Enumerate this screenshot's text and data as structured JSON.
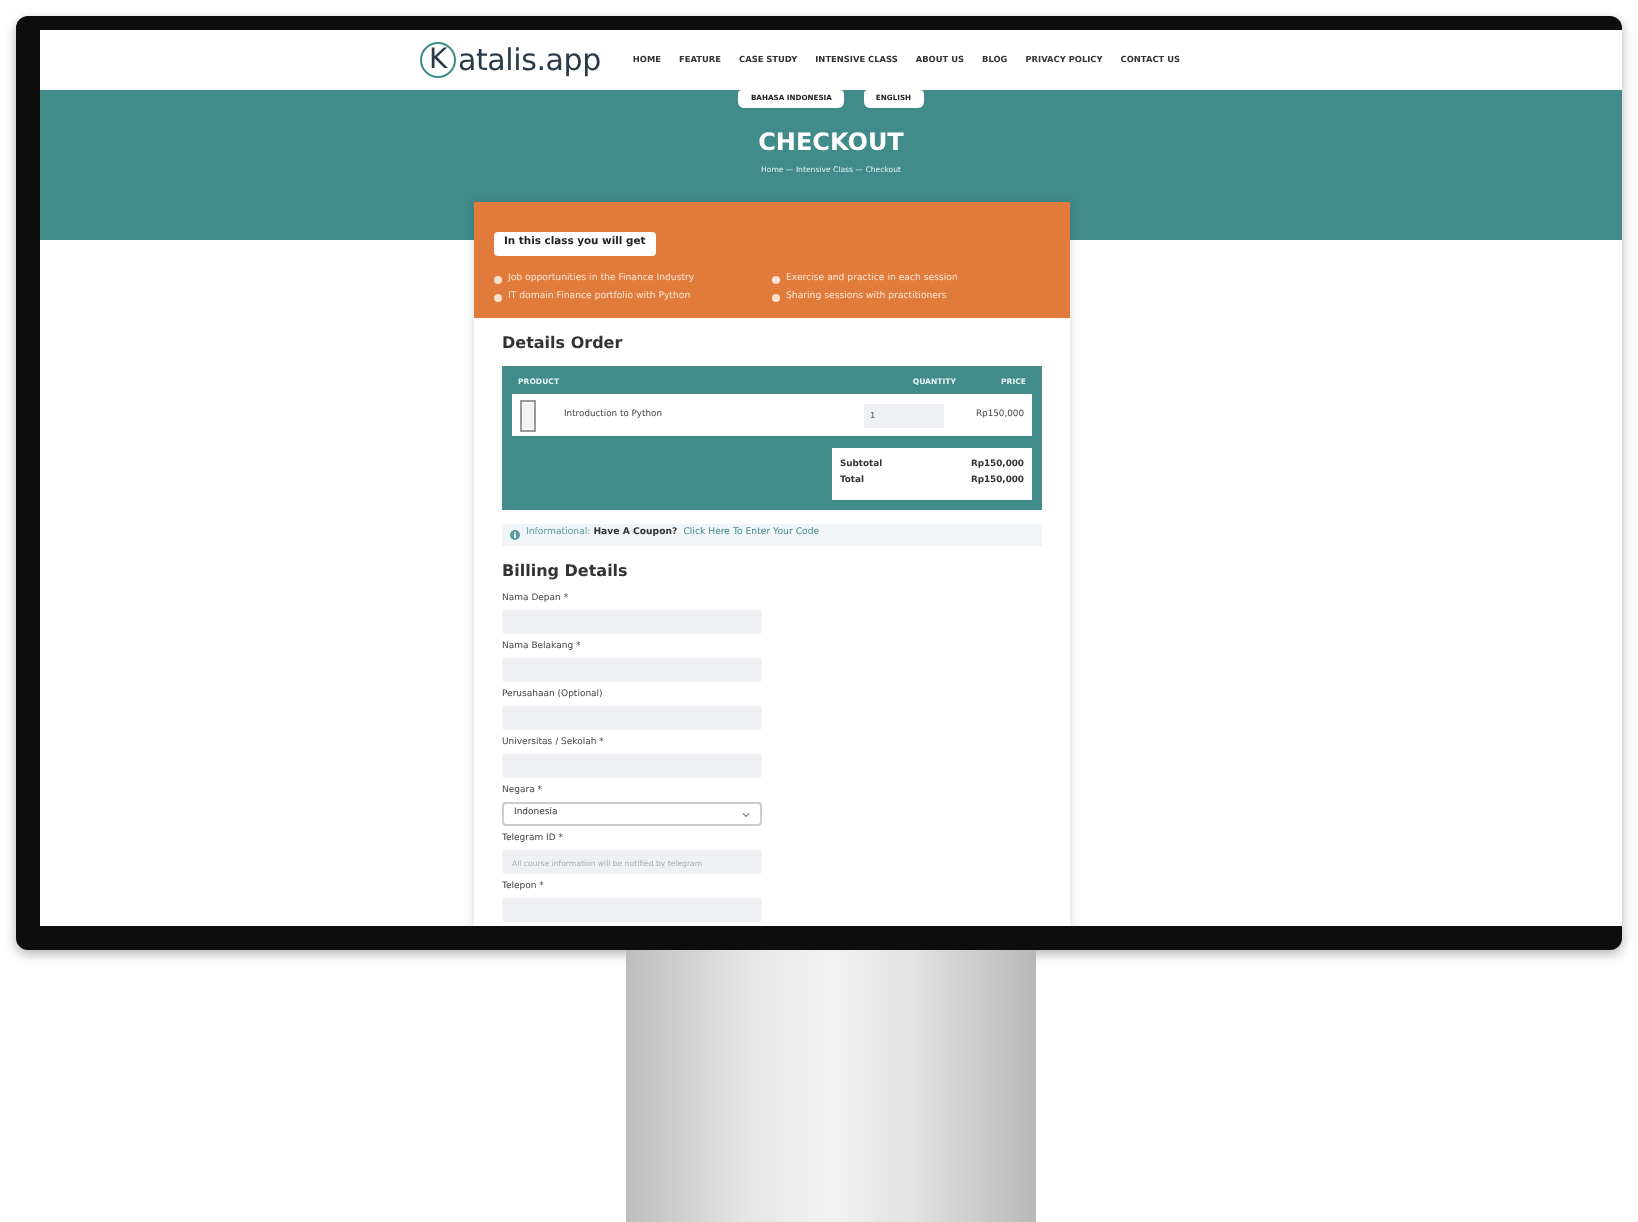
{
  "nav": {
    "logo_letter": "K",
    "logo_rest": "atalis.app",
    "links": [
      "HOME",
      "FEATURE",
      "CASE STUDY",
      "INTENSIVE CLASS",
      "ABOUT US",
      "BLOG",
      "PRIVACY POLICY",
      "CONTACT US"
    ]
  },
  "language_buttons": [
    "BAHASA INDONESIA",
    "ENGLISH"
  ],
  "hero": {
    "title": "CHECKOUT",
    "breadcrumb": "Home  — Intensive Class  — Checkout"
  },
  "benefits": {
    "title": "In this class you will get",
    "items": [
      "Job opportunities in the Finance Industry",
      "Exercise and practice in each session",
      "IT domain Finance portfolio with Python",
      "Sharing sessions with practitioners"
    ]
  },
  "order": {
    "title": "Details Order",
    "columns": [
      "PRODUCT",
      "QUANTITY",
      "PRICE"
    ],
    "rows": [
      {
        "product": "Introduction to Python",
        "quantity": "1",
        "price": "Rp150,000"
      }
    ],
    "totals": [
      {
        "label": "Subtotal",
        "value": "Rp150,000"
      },
      {
        "label": "Total",
        "value": "Rp150,000"
      }
    ]
  },
  "coupon": {
    "text": "Informational: **Have A Coupon?**",
    "link": "Click Here To Enter Your Code"
  },
  "billing": {
    "title": "Billing Details",
    "fields": [
      {
        "kind": "text",
        "label": "Nama Depan *"
      },
      {
        "kind": "text",
        "label": "Nama Belakang *"
      },
      {
        "kind": "text",
        "label": "Perusahaan (Optional)"
      },
      {
        "kind": "text",
        "label": "Universitas / Sekolah *"
      },
      {
        "kind": "select",
        "label": "Negara *",
        "value": "Indonesia"
      },
      {
        "kind": "text",
        "label": "Telegram ID *",
        "placeholder": "All course information will be notified by telegram"
      },
      {
        "kind": "text",
        "label": "Telepon *"
      }
    ]
  }
}
